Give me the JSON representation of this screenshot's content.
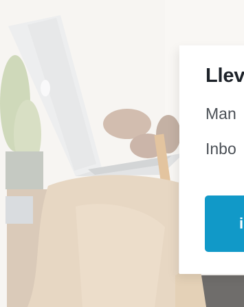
{
  "promo": {
    "title": "Llev",
    "line1": "Man",
    "line2": "Inbo",
    "cta_label": "i",
    "accent_color": "#1199c8"
  },
  "hero_image": {
    "subject": "person-with-laptop-photo"
  }
}
